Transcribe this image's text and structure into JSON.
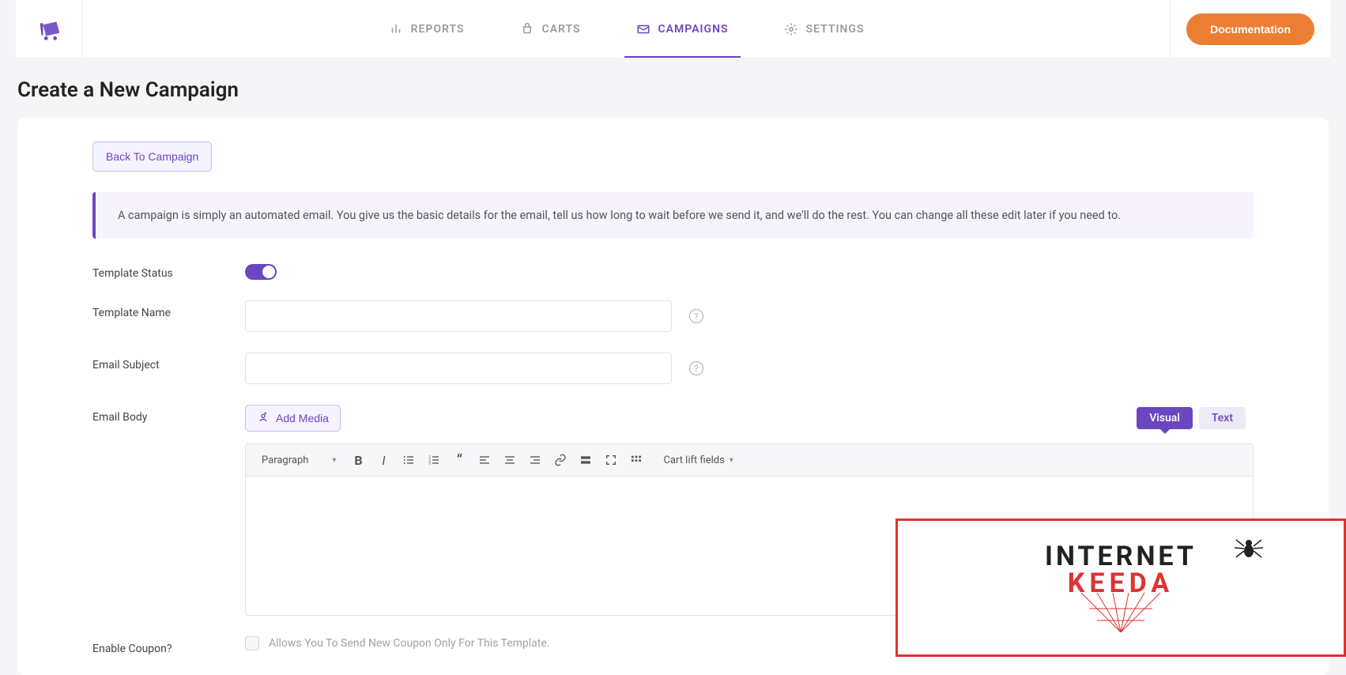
{
  "nav": {
    "reports": "REPORTS",
    "carts": "CARTS",
    "campaigns": "CAMPAIGNS",
    "settings": "SETTINGS"
  },
  "doc_button": "Documentation",
  "page_title": "Create a New Campaign",
  "back_button": "Back To Campaign",
  "info_text": "A campaign is simply an automated email. You give us the basic details for the email, tell us how long to wait before we send it, and we'll do the rest. You can change all these edit later if you need to.",
  "labels": {
    "template_status": "Template Status",
    "template_name": "Template Name",
    "email_subject": "Email Subject",
    "email_body": "Email Body",
    "enable_coupon": "Enable Coupon?"
  },
  "add_media": "Add Media",
  "tabs": {
    "visual": "Visual",
    "text": "Text"
  },
  "toolbar": {
    "paragraph": "Paragraph",
    "fields": "Cart lift fields"
  },
  "coupon_desc": "Allows You To Send New Coupon Only For This Template.",
  "watermark": {
    "top": "INTERNET",
    "bottom": "KEEDA"
  }
}
